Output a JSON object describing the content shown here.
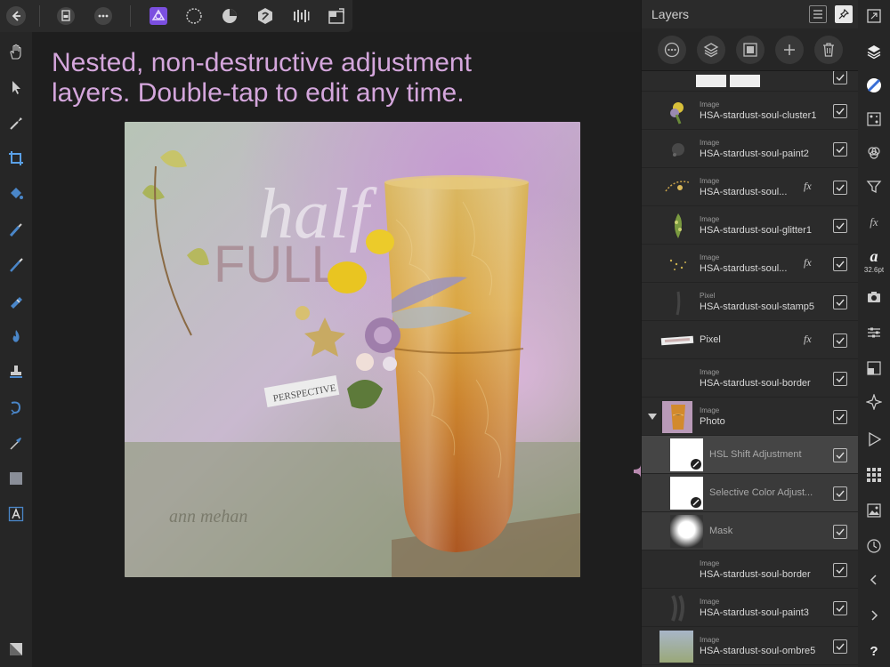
{
  "caption": {
    "line1": "Nested, non-destructive adjustment",
    "line2": "layers. Double-tap to edit any time."
  },
  "layers_panel": {
    "title": "Layers",
    "layers": [
      {
        "type": "Image",
        "name": "HSA-stardust-soul-cluster1",
        "fx": ""
      },
      {
        "type": "Image",
        "name": "HSA-stardust-soul-paint2",
        "fx": ""
      },
      {
        "type": "Image",
        "name": "HSA-stardust-soul...",
        "fx": "fx"
      },
      {
        "type": "Image",
        "name": "HSA-stardust-soul-glitter1",
        "fx": ""
      },
      {
        "type": "Image",
        "name": "HSA-stardust-soul...",
        "fx": "fx"
      },
      {
        "type": "Pixel",
        "name": "HSA-stardust-soul-stamp5",
        "fx": ""
      },
      {
        "type": "",
        "name": "Pixel",
        "fx": "fx"
      },
      {
        "type": "Image",
        "name": "HSA-stardust-soul-border",
        "fx": ""
      },
      {
        "type": "Image",
        "name": "Photo",
        "fx": ""
      },
      {
        "type": "",
        "name": "HSL Shift Adjustment",
        "fx": ""
      },
      {
        "type": "",
        "name": "Selective Color Adjust...",
        "fx": ""
      },
      {
        "type": "",
        "name": "Mask",
        "fx": ""
      },
      {
        "type": "Image",
        "name": "HSA-stardust-soul-border",
        "fx": ""
      },
      {
        "type": "Image",
        "name": "HSA-stardust-soul-paint3",
        "fx": ""
      },
      {
        "type": "Image",
        "name": "HSA-stardust-soul-ombre5",
        "fx": ""
      }
    ]
  },
  "artwork_text": {
    "word1": "half",
    "word2": "FULL",
    "tag": "PERSPECTIVE",
    "signature": "ann mehan"
  },
  "right_strip": {
    "font_size": "32.6pt"
  },
  "colors": {
    "caption": "#d4a6dc",
    "accent": "#8b5cf6",
    "bracket": "#b98ab0"
  }
}
